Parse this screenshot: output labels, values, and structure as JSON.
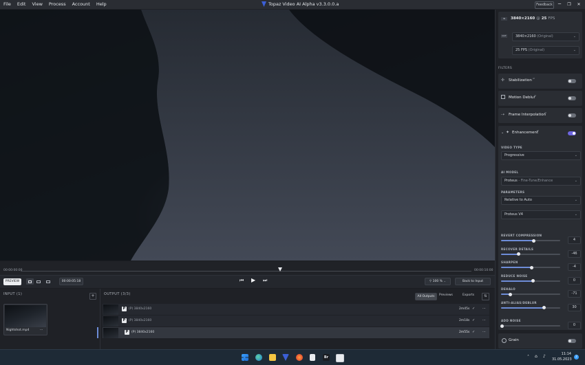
{
  "menu": [
    "File",
    "Edit",
    "View",
    "Process",
    "Account",
    "Help"
  ],
  "app_title": "Topaz Video AI Alpha  v3.3.0.0.a",
  "window": {
    "feedback": "Feedback",
    "minimize": "─",
    "maximize": "❐",
    "close": "✕"
  },
  "timeline": {
    "start": "00:00:00:00",
    "end": "00:00:10:00"
  },
  "controls": {
    "preview": "PREVIEW",
    "timecode": "00:00:05:18",
    "zoom": "100",
    "zoom_unit": "%",
    "back_to_input": "Back to Input",
    "add": "+"
  },
  "input": {
    "title": "INPUT (1)",
    "filename": "Nightshot.mp4",
    "more": "···"
  },
  "output": {
    "title": "OUTPUT (3/3)",
    "tabs": [
      "All Outputs",
      "Previews",
      "Exports"
    ],
    "rows": [
      {
        "badge": "P",
        "label": "(P) 3840x2160",
        "time": "2m45s"
      },
      {
        "badge": "P",
        "label": "(P) 3840x2160",
        "time": "2m18s"
      },
      {
        "badge": "P",
        "label": "(P)  3840x2160",
        "time": "2m55s"
      }
    ]
  },
  "right_panel": {
    "res_badge": "IN",
    "res_title_left": "3840×2160",
    "res_title_mid": "@",
    "res_title_right": "25",
    "res_title_unit": "FPS",
    "out_badge": "OUT",
    "res_select": "3840×2160",
    "res_select_note": "(Original)",
    "fps_select": "25 FPS",
    "fps_select_note": "(Original)",
    "filters_label": "FILTERS",
    "filters": [
      {
        "name": "Stabilization",
        "sup": "AI",
        "on": false
      },
      {
        "name": "Motion Deblur",
        "sup": "AI",
        "on": false
      },
      {
        "name": "Frame Interpolation",
        "sup": "AI",
        "on": false
      }
    ],
    "enhancement": {
      "name": "Enhancement",
      "sup": "AI",
      "on": true
    },
    "video_type_label": "VIDEO TYPE",
    "video_type": "Progressive",
    "ai_model_label": "AI MODEL",
    "ai_model": "Proteus",
    "ai_model_note": "- Fine-Tune/Enhance",
    "parameters_label": "PARAMETERS",
    "parameters_mode": "Relative to Auto",
    "parameters_preset": "Proteus V4",
    "sliders": [
      {
        "label": "REVERT COMPRESSION",
        "value": "4",
        "level": 0.55
      },
      {
        "label": "RECOVER DETAILS",
        "value": "-46",
        "level": 0.3
      },
      {
        "label": "SHARPEN",
        "value": "-4",
        "level": 0.52
      },
      {
        "label": "REDUCE NOISE",
        "value": "0",
        "level": 0.54
      },
      {
        "label": "DEHALO",
        "value": "-71",
        "level": 0.16
      },
      {
        "label": "ANTI-ALIAS/DEBLUR",
        "value": "30",
        "level": 0.73
      },
      {
        "label": "ADD NOISE",
        "value": "0",
        "level": 0.02
      }
    ],
    "grain": {
      "name": "Grain",
      "on": false
    }
  },
  "taskbar": {
    "time": "11:14",
    "date": "31.05.2023",
    "notifications": "2"
  },
  "colors": {
    "accent": "#6e66e0",
    "panel": "#1f2126",
    "card": "#2a2d33"
  }
}
